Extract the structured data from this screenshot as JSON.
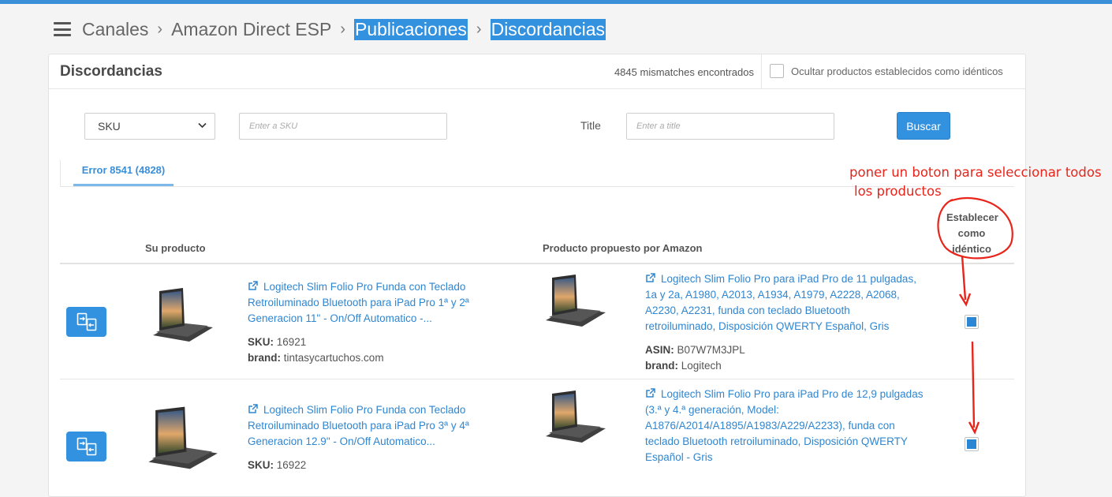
{
  "breadcrumb": {
    "items": [
      {
        "label": "Canales"
      },
      {
        "label": "Amazon Direct ESP"
      },
      {
        "label": "Publicaciones"
      },
      {
        "label": "Discordancias"
      }
    ]
  },
  "panel": {
    "title": "Discordancias",
    "mismatch_count": "4845 mismatches encontrados",
    "hide_identical_label": "Ocultar productos establecidos como idénticos"
  },
  "filters": {
    "select_value": "SKU",
    "sku_placeholder": "Enter a SKU",
    "title_label": "Title",
    "title_placeholder": "Enter a title",
    "search_button": "Buscar"
  },
  "tabs": [
    {
      "label": "Error 8541 (4828)"
    }
  ],
  "table": {
    "col_su_producto": "Su producto",
    "col_propuesto": "Producto propuesto por Amazon",
    "col_establecer": [
      "Establecer",
      "como",
      "idéntico"
    ]
  },
  "rows": [
    {
      "own_title": "Logitech Slim Folio Pro Funda con Teclado Retroiluminado Bluetooth para iPad Pro 1ª y 2ª Generacion 11\" - On/Off Automatico -...",
      "sku_label": "SKU:",
      "sku": "16921",
      "brand_label": "brand:",
      "brand": "tintasycartuchos.com",
      "amazon_title": "Logitech Slim Folio Pro para iPad Pro de 11 pulgadas, 1a y 2a, A1980, A2013, A1934, A1979, A2228, A2068, A2230, A2231, funda con teclado Bluetooth retroiluminado, Disposición QWERTY Español, Gris",
      "asin_label": "ASIN:",
      "asin": "B07W7M3JPL",
      "amazon_brand_label": "brand:",
      "amazon_brand": "Logitech",
      "checked": true
    },
    {
      "own_title": "Logitech Slim Folio Pro Funda con Teclado Retroiluminado Bluetooth para iPad Pro 3ª y 4ª Generacion 12.9\" - On/Off Automatico...",
      "sku_label": "SKU:",
      "sku": "16922",
      "amazon_title": "Logitech Slim Folio Pro para iPad Pro de 12,9 pulgadas (3.ª y 4.ª generación, Model: A1876/A2014/A1895/A1983/A229/A2233), funda con teclado Bluetooth retroiluminado, Disposición QWERTY Español - Gris",
      "checked": true
    }
  ],
  "annotation": {
    "line1": "poner un boton para seleccionar todos",
    "line2": "los productos",
    "color": "#e8251b"
  },
  "colors": {
    "accent": "#3392e0",
    "link": "#2f86d1",
    "annotation": "#e8251b"
  }
}
